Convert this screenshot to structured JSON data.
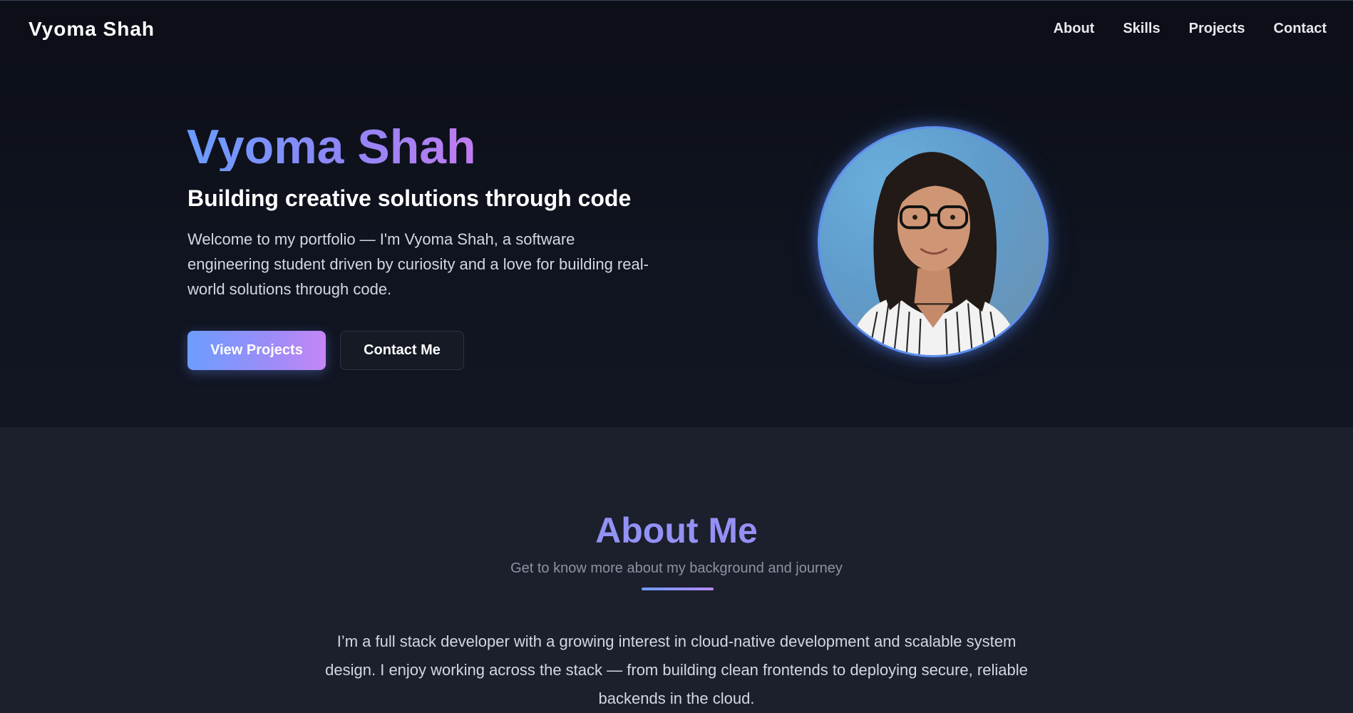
{
  "header": {
    "brand": "Vyoma Shah",
    "nav": [
      {
        "label": "About"
      },
      {
        "label": "Skills"
      },
      {
        "label": "Projects"
      },
      {
        "label": "Contact"
      }
    ]
  },
  "hero": {
    "name": "Vyoma Shah",
    "tagline": "Building creative solutions through code",
    "intro": "Welcome to my portfolio — I'm Vyoma Shah, a software engineering student driven by curiosity and a love for building real-world solutions through code.",
    "primary_button": "View Projects",
    "secondary_button": "Contact Me",
    "photo_icon": "profile-photo"
  },
  "about": {
    "title": "About Me",
    "subtitle": "Get to know more about my background and journey",
    "text": "I’m a full stack developer with a growing interest in cloud-native development and scalable system design. I enjoy working across the stack — from building clean frontends to deploying secure, reliable backends in the cloud."
  },
  "colors": {
    "accent_blue": "#6a9cff",
    "accent_purple": "#c17cf0",
    "header_bg": "#0c0f17",
    "section_bg": "#1c1f2c"
  }
}
